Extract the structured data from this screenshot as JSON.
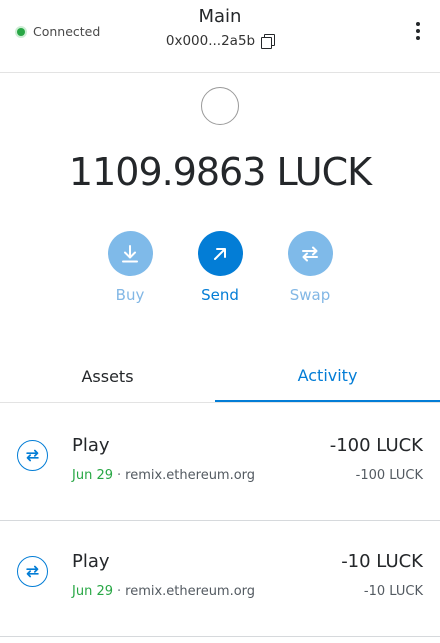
{
  "header": {
    "connection_status": "Connected",
    "account_name": "Main",
    "account_address": "0x000...2a5b"
  },
  "balance": {
    "amount": "1109.9863",
    "symbol": "LUCK"
  },
  "actions": {
    "buy": "Buy",
    "send": "Send",
    "swap": "Swap"
  },
  "tabs": {
    "assets": "Assets",
    "activity": "Activity"
  },
  "transactions": [
    {
      "title": "Play",
      "date": "Jun 29",
      "separator": "·",
      "origin": "remix.ethereum.org",
      "amount": "-100 LUCK",
      "secondary_amount": "-100 LUCK"
    },
    {
      "title": "Play",
      "date": "Jun 29",
      "separator": "·",
      "origin": "remix.ethereum.org",
      "amount": "-10 LUCK",
      "secondary_amount": "-10 LUCK"
    }
  ],
  "colors": {
    "primary": "#037dd6",
    "primary_disabled": "#7fbae9",
    "success": "#28a745",
    "text": "#24272a"
  }
}
